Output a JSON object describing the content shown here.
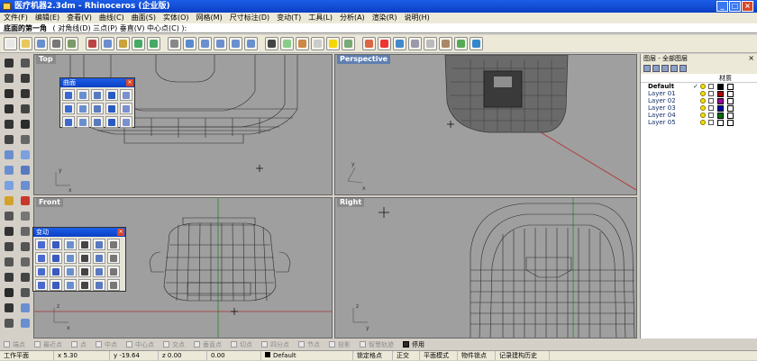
{
  "window": {
    "title": "医疗机器2.3dm - Rhinoceros (企业版)",
    "buttons": [
      "_",
      "□",
      "×"
    ]
  },
  "menu": [
    "文件(F)",
    "编辑(E)",
    "查看(V)",
    "曲线(C)",
    "曲面(S)",
    "实体(O)",
    "网格(M)",
    "尺寸标注(D)",
    "变动(T)",
    "工具(L)",
    "分析(A)",
    "渲染(R)",
    "说明(H)"
  ],
  "command": {
    "prompt": "底面的第一角",
    "options": "( 对角线(D)  三点(P)  垂直(V)  中心点(C) ):"
  },
  "toolbar_icons": [
    "new-icon",
    "open-icon",
    "save-icon",
    "print-icon",
    "import-icon",
    "cut-icon",
    "copy-icon",
    "paste-icon",
    "undo-icon",
    "redo-icon",
    "pan-icon",
    "rotate-view-icon",
    "zoom-icon",
    "zoom-window-icon",
    "zoom-extents-icon",
    "zoom-selected-icon",
    "pointer-icon",
    "grid-icon",
    "layer-icon",
    "properties-icon",
    "lightbulb-icon",
    "render-icon",
    "color-icon",
    "material-icon",
    "sphere-icon",
    "shaded-icon",
    "ghosted-icon",
    "options-icon",
    "osnap-icon",
    "help-icon"
  ],
  "viewports": {
    "top": "Top",
    "perspective": "Perspective",
    "front": "Front",
    "right": "Right"
  },
  "palettes": {
    "surface": {
      "title": "曲面",
      "close": "×"
    },
    "transform": {
      "title": "变动",
      "close": "×"
    }
  },
  "layers": {
    "title": "图层 - 全部图层",
    "close": "×",
    "col_name": "",
    "col_state": "",
    "col_material": "材质",
    "rows": [
      {
        "name": "Default",
        "current": true,
        "check": "✓",
        "color": "#000000"
      },
      {
        "name": "Layer 01",
        "current": false,
        "check": "",
        "color": "#b00000"
      },
      {
        "name": "Layer 02",
        "current": false,
        "check": "",
        "color": "#a000a0"
      },
      {
        "name": "Layer 03",
        "current": false,
        "check": "",
        "color": "#0000b0"
      },
      {
        "name": "Layer 04",
        "current": false,
        "check": "",
        "color": "#007000"
      },
      {
        "name": "Layer 05",
        "current": false,
        "check": "",
        "color": "#ffffff"
      }
    ]
  },
  "osnaps": [
    {
      "label": "端点",
      "on": false
    },
    {
      "label": "最近点",
      "on": false
    },
    {
      "label": "点",
      "on": false
    },
    {
      "label": "中点",
      "on": false
    },
    {
      "label": "中心点",
      "on": false
    },
    {
      "label": "交点",
      "on": false
    },
    {
      "label": "垂直点",
      "on": false
    },
    {
      "label": "切点",
      "on": false
    },
    {
      "label": "四分点",
      "on": false
    },
    {
      "label": "节点",
      "on": false
    },
    {
      "label": "投影",
      "on": false
    },
    {
      "label": "智慧轨迹",
      "on": false
    },
    {
      "label": "停用",
      "on": true
    }
  ],
  "status": {
    "cplane": "工作平面",
    "x": "x 5.30",
    "y": "y -19.64",
    "z": "z 0.00",
    "extra": "0.00",
    "layer": "Default",
    "snap": "锁定格点",
    "ortho": "正交",
    "planar": "平面模式",
    "osnap": "物件锁点",
    "history": "记录建构历史"
  }
}
